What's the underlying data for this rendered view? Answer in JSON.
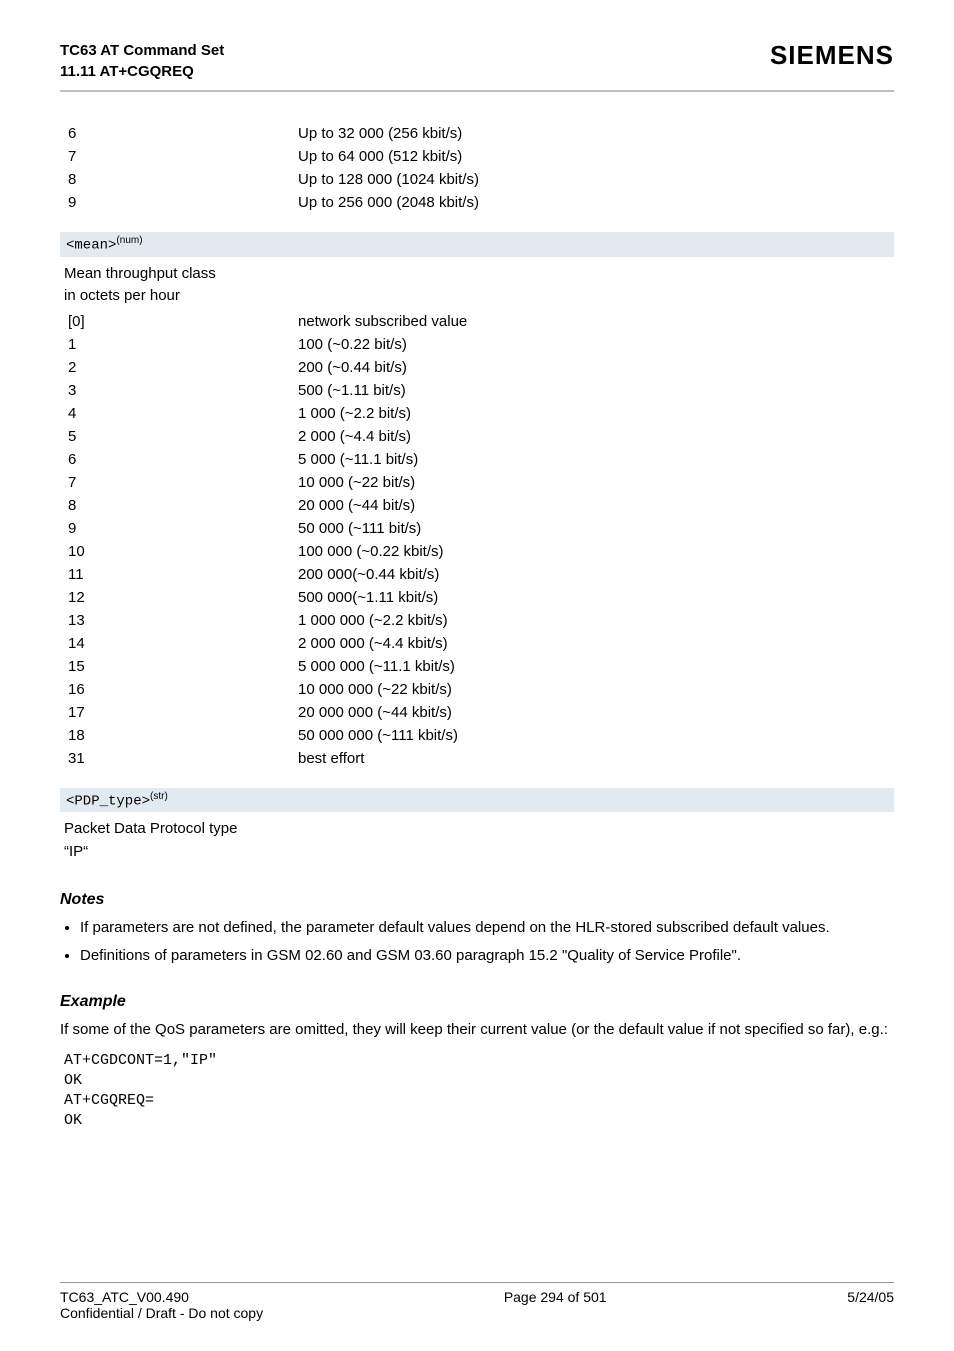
{
  "header": {
    "title_line1": "TC63 AT Command Set",
    "title_line2": "11.11 AT+CGQREQ",
    "brand": "SIEMENS"
  },
  "top_rows": [
    {
      "k": "6",
      "v": "Up to 32 000 (256 kbit/s)"
    },
    {
      "k": "7",
      "v": "Up to 64 000 (512 kbit/s)"
    },
    {
      "k": "8",
      "v": "Up to 128 000 (1024 kbit/s)"
    },
    {
      "k": "9",
      "v": "Up to 256 000 (2048 kbit/s)"
    }
  ],
  "mean": {
    "tag": "<mean>",
    "sup": "(num)",
    "desc1": "Mean throughput class",
    "desc2": "in octets per hour",
    "rows": [
      {
        "k": "[0]",
        "v": "network subscribed value"
      },
      {
        "k": "1",
        "v": "100 (~0.22 bit/s)"
      },
      {
        "k": "2",
        "v": "200 (~0.44 bit/s)"
      },
      {
        "k": "3",
        "v": "500 (~1.11 bit/s)"
      },
      {
        "k": "4",
        "v": "1 000 (~2.2 bit/s)"
      },
      {
        "k": "5",
        "v": "2 000 (~4.4 bit/s)"
      },
      {
        "k": "6",
        "v": "5 000 (~11.1 bit/s)"
      },
      {
        "k": "7",
        "v": "10 000 (~22 bit/s)"
      },
      {
        "k": "8",
        "v": "20 000 (~44 bit/s)"
      },
      {
        "k": "9",
        "v": "50 000 (~111 bit/s)"
      },
      {
        "k": "10",
        "v": "100 000 (~0.22 kbit/s)"
      },
      {
        "k": "11",
        "v": "200 000(~0.44 kbit/s)"
      },
      {
        "k": "12",
        "v": "500 000(~1.11 kbit/s)"
      },
      {
        "k": "13",
        "v": "1 000 000 (~2.2 kbit/s)"
      },
      {
        "k": "14",
        "v": "2 000 000 (~4.4 kbit/s)"
      },
      {
        "k": "15",
        "v": "5 000 000 (~11.1 kbit/s)"
      },
      {
        "k": "16",
        "v": "10 000 000 (~22 kbit/s)"
      },
      {
        "k": "17",
        "v": "20 000 000 (~44 kbit/s)"
      },
      {
        "k": "18",
        "v": "50 000 000 (~111 kbit/s)"
      },
      {
        "k": "31",
        "v": "best effort"
      }
    ]
  },
  "pdp": {
    "tag": "<PDP_type>",
    "sup": "(str)",
    "desc1": "Packet Data Protocol type",
    "desc2": "“IP“"
  },
  "notes": {
    "title": "Notes",
    "items": [
      "If parameters are not defined, the parameter default values depend on the HLR-stored subscribed default values.",
      "Definitions of parameters in GSM 02.60 and GSM 03.60 paragraph 15.2 \"Quality of Service Profile\"."
    ]
  },
  "example": {
    "title": "Example",
    "intro": "If some of the QoS parameters are omitted, they will keep their current value (or the default value if not specified so far), e.g.:",
    "code": "AT+CGDCONT=1,\"IP\"\nOK\nAT+CGQREQ=\nOK"
  },
  "footer": {
    "left1": "TC63_ATC_V00.490",
    "left2": "Confidential / Draft - Do not copy",
    "center": "Page 294 of 501",
    "right": "5/24/05"
  }
}
